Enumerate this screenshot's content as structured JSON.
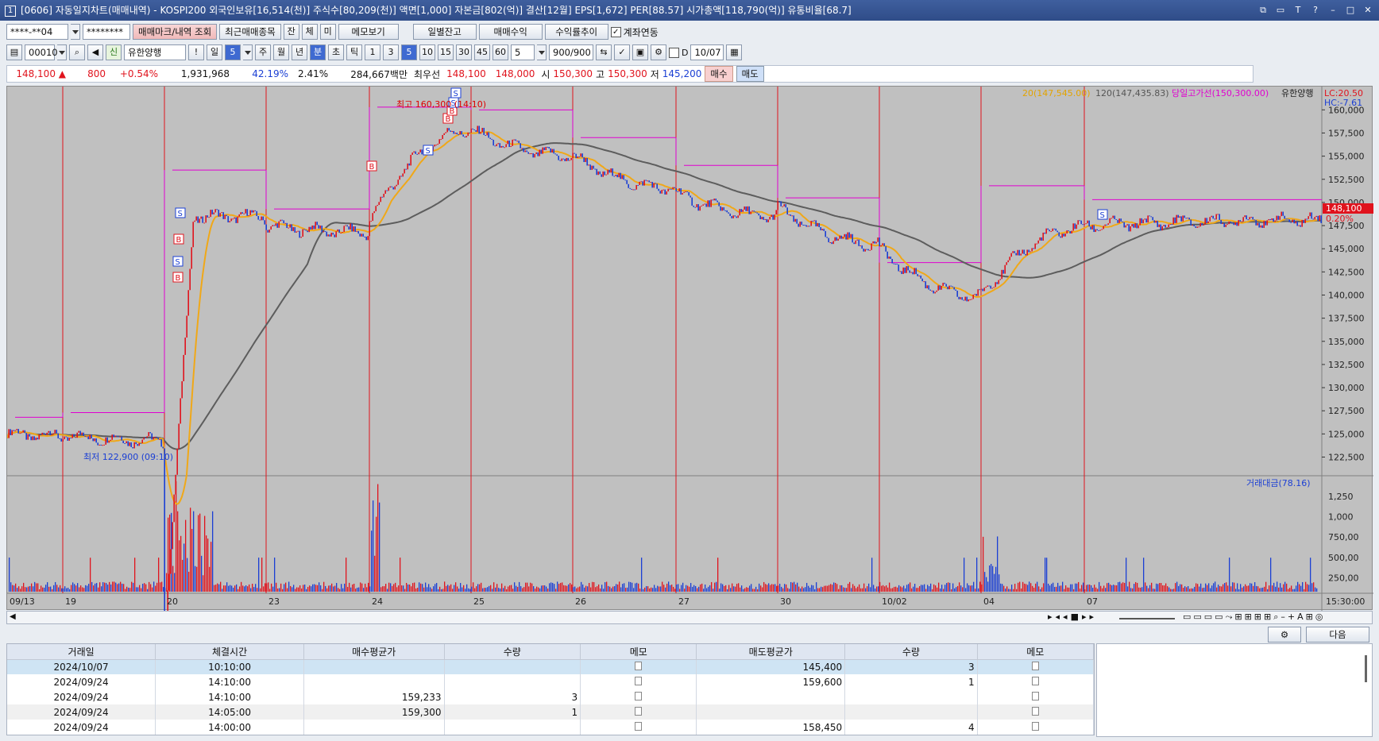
{
  "title": {
    "screen_no": "[0606]",
    "text": "[0606] 자동일지차트(매매내역) - KOSPI200 외국인보유[16,514(천)] 주식수[80,209(천)] 액면[1,000] 자본금[802(억)] 결산[12월] EPS[1,672] PER[88.57] 시가총액[118,790(억)] 유통비율[68.7]"
  },
  "toolbar1": {
    "account": "****-**04",
    "password": "********",
    "trade_mark_btn": "매매마크/내역 조회",
    "recent_btn": "최근매매종목",
    "jan": "잔",
    "che": "체",
    "mi": "미",
    "memo_btn": "메모보기",
    "daily_btn": "일별잔고",
    "profit_btn": "매매수익",
    "yield_btn": "수익률추이",
    "account_link": "계좌연동"
  },
  "toolbar2": {
    "code": "000100",
    "shin": "신",
    "stock_name": "유한양행",
    "exclaim": "!",
    "il": "일",
    "five": "5",
    "ju": "주",
    "wol": "월",
    "nyeon": "년",
    "bun": "분",
    "cho": "초",
    "tick": "틱",
    "intervals": [
      "1",
      "3",
      "5",
      "10",
      "15",
      "30",
      "45",
      "60"
    ],
    "period": "5",
    "count": "900/900",
    "d_label": "D",
    "date": "10/07"
  },
  "quote": {
    "price": "148,100",
    "change": "800",
    "rate": "+0.54%",
    "volume": "1,931,968",
    "turn": "42.19%",
    "vol_ratio": "2.41%",
    "amount": "284,667백만",
    "best_label": "최우선",
    "ask": "148,100",
    "bid": "148,000",
    "open_label": "시",
    "open": "150,300",
    "high_label": "고",
    "high": "150,300",
    "low_label": "저",
    "low": "145,200",
    "buy_btn": "매수",
    "sell_btn": "매도"
  },
  "chart_data": {
    "type": "line",
    "title": "",
    "legend": {
      "ma20": "20(147,545.00)",
      "ma120": "120(147,435.83)",
      "daily_high_line": "당일고가선(150,300.00)",
      "stock": "유한양행"
    },
    "lc": "LC:20.50",
    "hc": "HC:-7.61",
    "current_price_label": "148,100",
    "current_change_label": "0.20%",
    "price_ylim": [
      121000,
      162000
    ],
    "price_ticks": [
      "160,000",
      "157,500",
      "155,000",
      "152,500",
      "150,000",
      "147,500",
      "145,000",
      "142,500",
      "140,000",
      "137,500",
      "135,000",
      "132,500",
      "130,000",
      "127,500",
      "125,000",
      "122,500"
    ],
    "high_annotation": "최고 160,300 (14:10)",
    "low_annotation": "최저 122,900 (09:10)",
    "x_labels": [
      "09/13",
      "19",
      "20",
      "23",
      "24",
      "25",
      "26",
      "27",
      "30",
      "10/02",
      "04",
      "07"
    ],
    "x_end_label": "15:30:00",
    "session_close": [
      {
        "date": "09/13",
        "close": 124800
      },
      {
        "date": "09/19",
        "close": 124300
      },
      {
        "date": "09/20",
        "close": 148500
      },
      {
        "date": "09/23",
        "close": 146800
      },
      {
        "date": "09/24",
        "close": 157800
      },
      {
        "date": "09/25",
        "close": 155000
      },
      {
        "date": "09/26",
        "close": 151500
      },
      {
        "date": "09/27",
        "close": 148500
      },
      {
        "date": "09/30",
        "close": 145500
      },
      {
        "date": "10/02",
        "close": 139800
      },
      {
        "date": "10/04",
        "close": 147300
      },
      {
        "date": "10/07",
        "close": 148100
      }
    ],
    "trade_marks": [
      {
        "date": "09/20",
        "side": "B"
      },
      {
        "date": "09/20",
        "side": "S"
      },
      {
        "date": "09/20",
        "side": "B"
      },
      {
        "date": "09/20",
        "side": "S"
      },
      {
        "date": "09/24",
        "side": "B"
      },
      {
        "date": "09/24",
        "side": "S"
      },
      {
        "date": "09/24",
        "side": "B"
      },
      {
        "date": "09/24",
        "side": "B"
      },
      {
        "date": "09/24",
        "side": "S"
      },
      {
        "date": "09/24",
        "side": "S"
      },
      {
        "date": "10/07",
        "side": "S"
      }
    ],
    "volume_panel": {
      "label": "거래대금(78.16)",
      "ticks": [
        "1,250",
        "1,000",
        "750,00",
        "500,00",
        "250,00"
      ]
    }
  },
  "bottom": {
    "next_btn": "다음",
    "columns": [
      "거래일",
      "체결시간",
      "매수평균가",
      "수량",
      "메모",
      "매도평균가",
      "수량",
      "메모"
    ],
    "rows": [
      [
        "2024/10/07",
        "10:10:00",
        "",
        "",
        "",
        "145,400",
        "3",
        ""
      ],
      [
        "2024/09/24",
        "14:10:00",
        "",
        "",
        "",
        "159,600",
        "1",
        ""
      ],
      [
        "2024/09/24",
        "14:10:00",
        "159,233",
        "3",
        "",
        "",
        "",
        ""
      ],
      [
        "2024/09/24",
        "14:05:00",
        "159,300",
        "1",
        "",
        "",
        "",
        ""
      ],
      [
        "2024/09/24",
        "14:00:00",
        "",
        "",
        "",
        "158,450",
        "4",
        ""
      ]
    ]
  }
}
